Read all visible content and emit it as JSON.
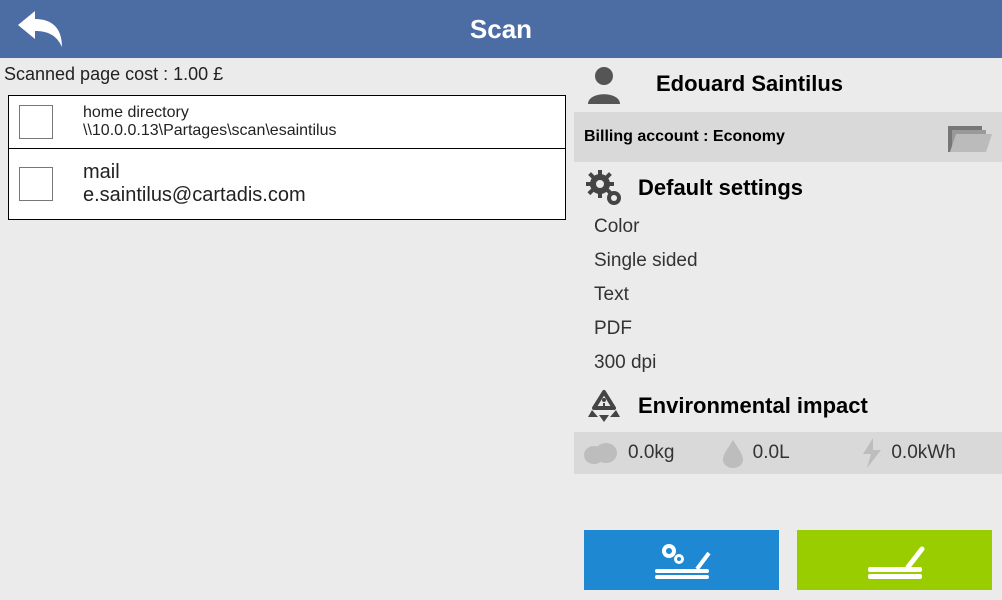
{
  "header": {
    "title": "Scan"
  },
  "cost_line": "Scanned page cost : 1.00 £",
  "destinations": [
    {
      "title": "home directory",
      "subtitle": "\\\\10.0.0.13\\Partages\\scan\\esaintilus"
    },
    {
      "title": "mail",
      "subtitle": "e.saintilus@cartadis.com"
    }
  ],
  "user": {
    "name": "Edouard Saintilus"
  },
  "billing": {
    "label": "Billing account : Economy"
  },
  "settings": {
    "heading": "Default settings",
    "items": [
      "Color",
      "Single sided",
      "Text",
      "PDF",
      "300 dpi"
    ]
  },
  "env": {
    "heading": "Environmental impact",
    "co2": "0.0kg",
    "water": "0.0L",
    "energy": "0.0kWh"
  }
}
